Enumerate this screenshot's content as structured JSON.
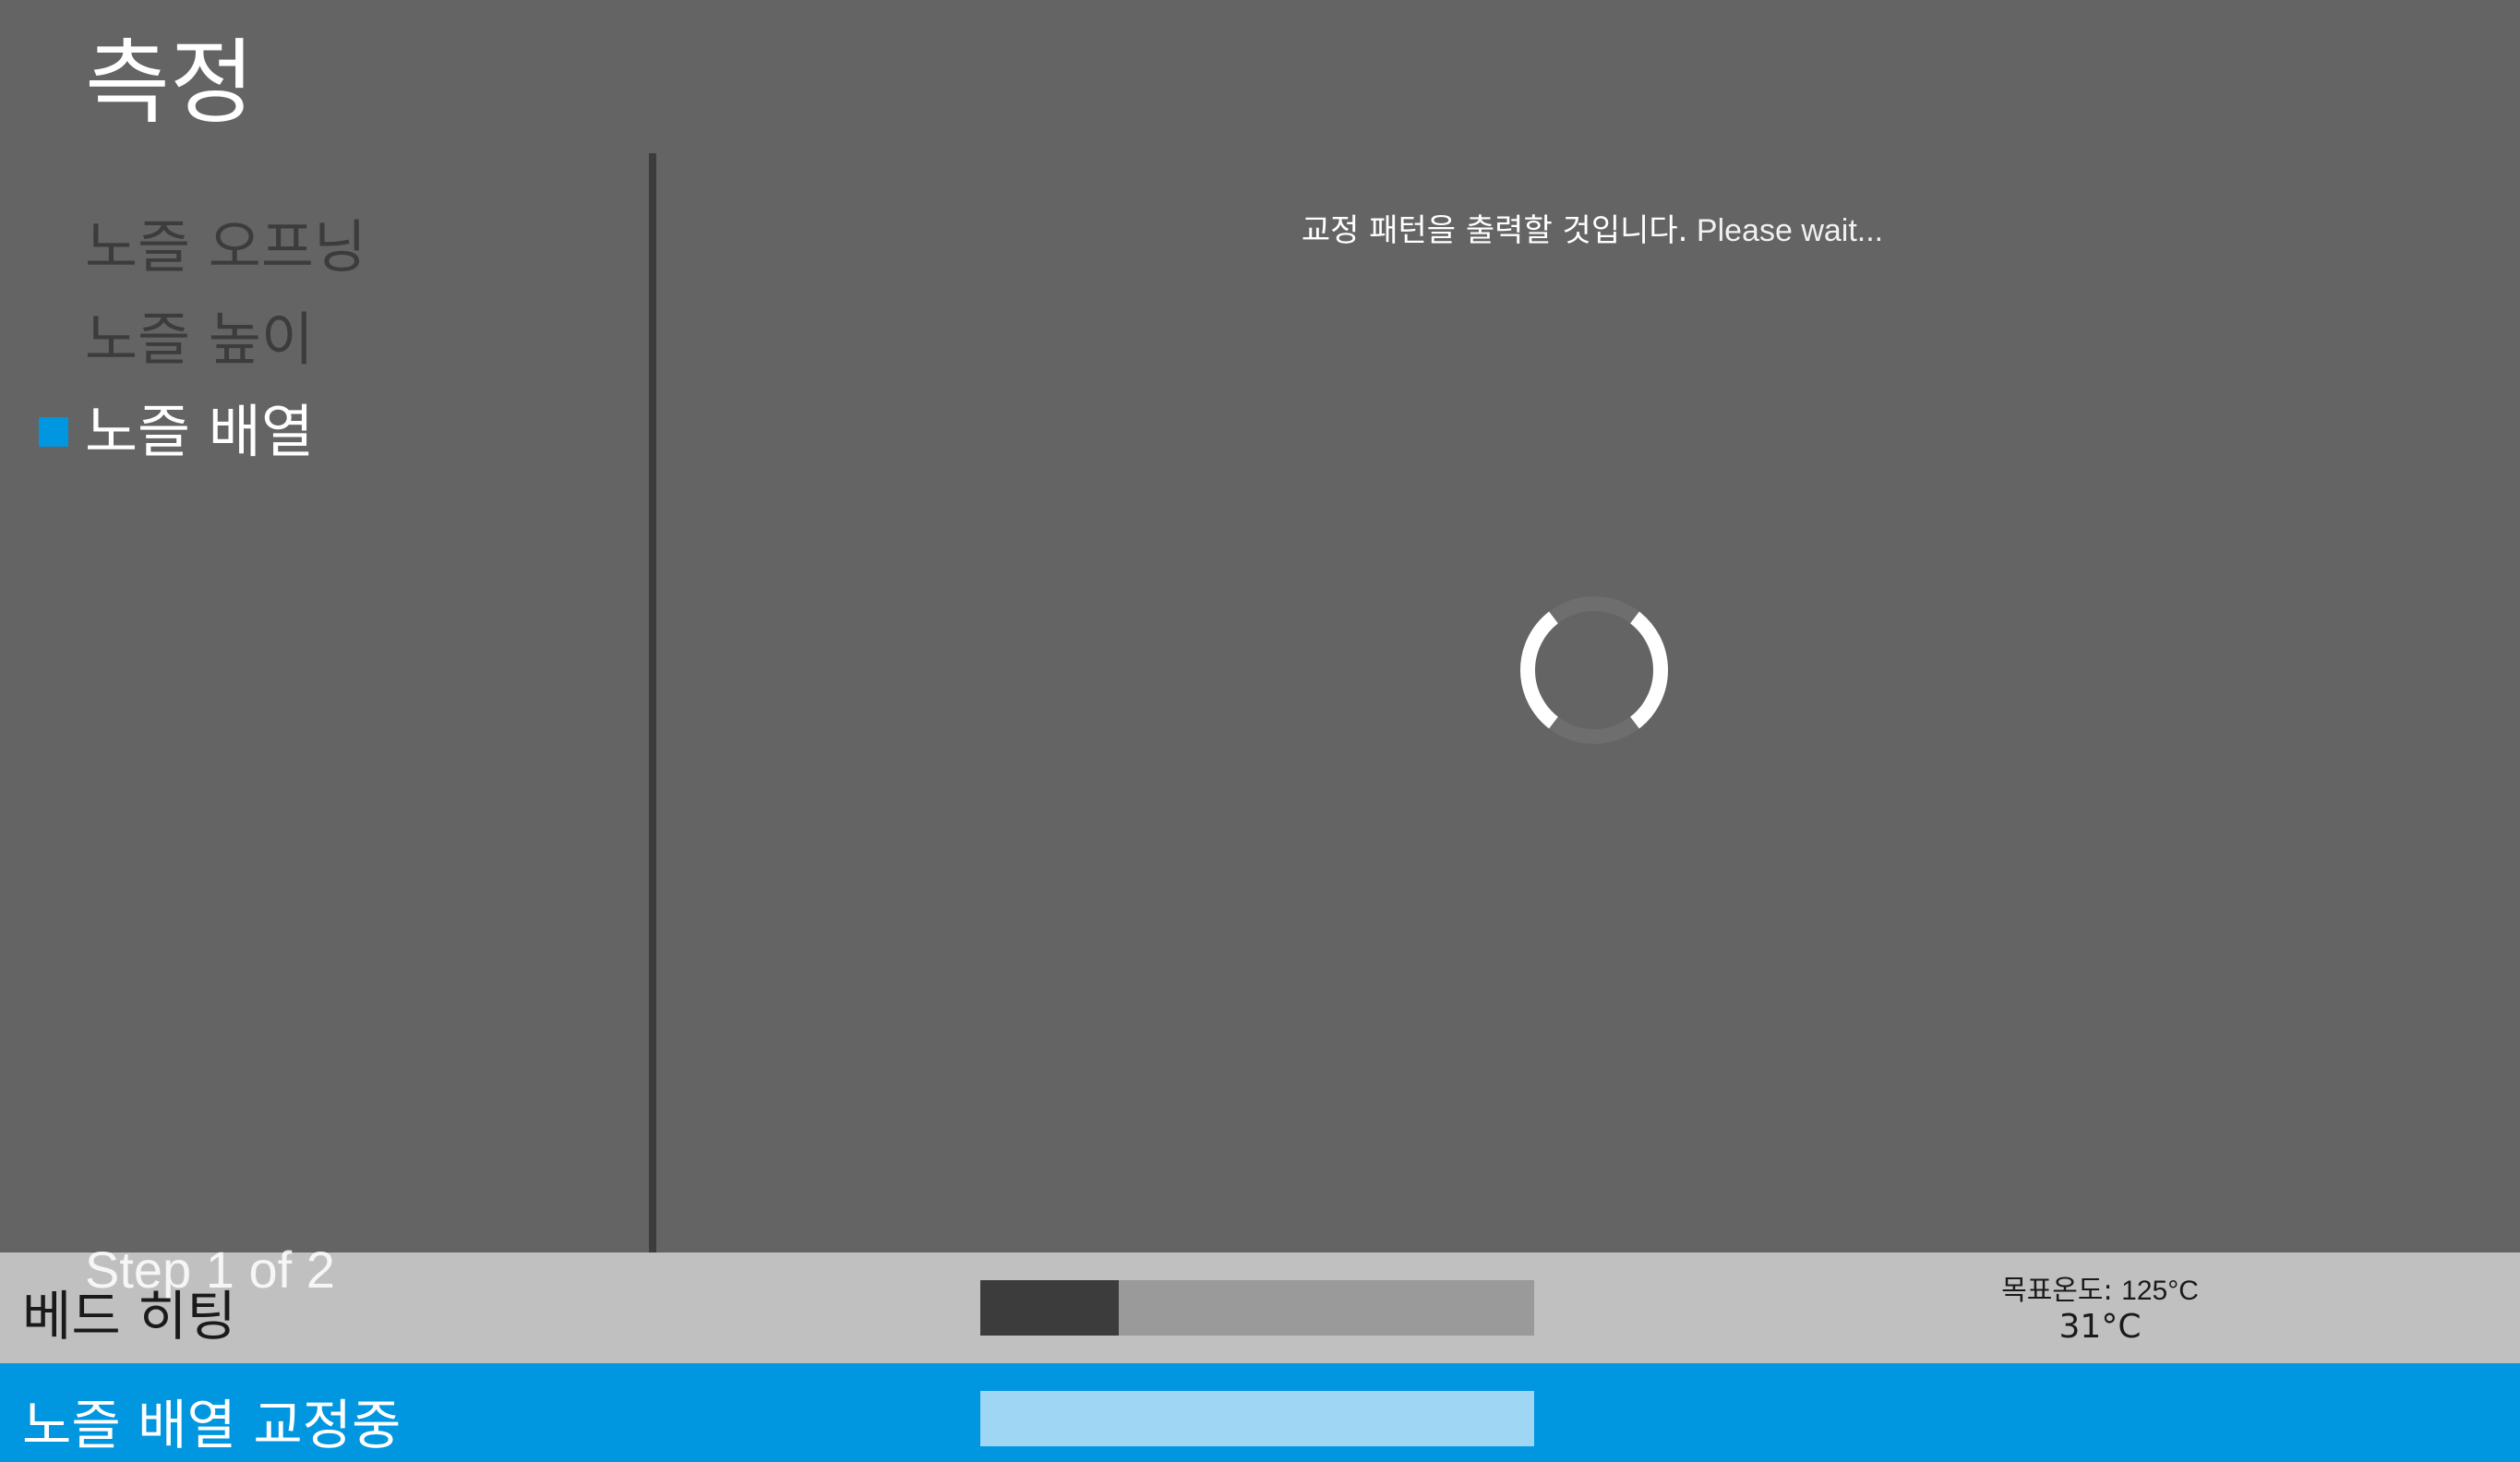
{
  "header": {
    "title": "측정"
  },
  "steps": {
    "items": [
      {
        "label": "노즐 오프닝",
        "active": false
      },
      {
        "label": "노즐 높이",
        "active": false
      },
      {
        "label": "노즐 배열",
        "active": true
      }
    ],
    "counter": "Step 1 of 2"
  },
  "main": {
    "message_korean": "교정 패턴을 출력할 것입니다.",
    "message_wait": " Please wait...",
    "spinner_icon": "loading-spinner-icon"
  },
  "status": {
    "label": "베드 히팅",
    "progress_fraction": 0.25,
    "target_label": "목표온도: ",
    "target_value": "125°C",
    "current_temp": "31°C"
  },
  "process": {
    "label": "노즐 배열 교정중"
  },
  "colors": {
    "background": "#646464",
    "accent": "#0096e0",
    "status_bar": "#c0c0c0",
    "progress_fill": "#3c3c3c",
    "progress_track": "#9a9a9a",
    "process_track": "#9ed6f4"
  }
}
